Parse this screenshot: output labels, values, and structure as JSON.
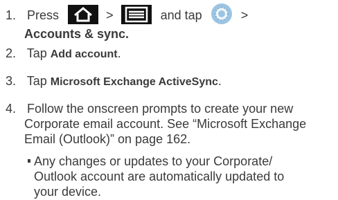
{
  "steps": [
    {
      "number": "1.",
      "press": "Press",
      "sep1": ">",
      "and_tap": "and tap",
      "sep2": ">",
      "bold_tail": "Accounts & sync."
    },
    {
      "number": "2.",
      "prefix": "Tap",
      "bold": "Add account",
      "suffix": "."
    },
    {
      "number": "3.",
      "prefix": "Tap",
      "bold": "Microsoft Exchange ActiveSync",
      "suffix": "."
    },
    {
      "number": "4.",
      "line1": "Follow the onscreen prompts to create your new",
      "line2": "Corporate email account. See “Microsoft Exchange",
      "line3": "Email (Outlook)” on page 162."
    }
  ],
  "bullet": {
    "line1": "Any changes or updates to your Corporate/",
    "line2": "Outlook account are automatically updated to",
    "line3": "your device."
  },
  "icons": {
    "home": "home-icon",
    "menu": "menu-icon",
    "settings": "settings-icon"
  }
}
